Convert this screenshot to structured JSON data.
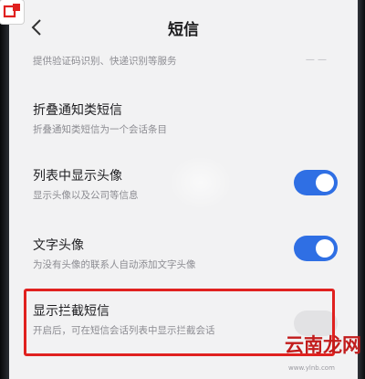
{
  "header": {
    "title": "短信"
  },
  "top_item": {
    "desc": "提供验证码识别、快递识别等服务"
  },
  "settings": [
    {
      "title": "折叠通知类短信",
      "desc": "折叠通知类短信为一个会话条目",
      "toggle": null
    },
    {
      "title": "列表中显示头像",
      "desc": "显示头像以及公司等信息",
      "toggle": "on"
    },
    {
      "title": "文字头像",
      "desc": "为没有头像的联系人自动添加文字头像",
      "toggle": "on"
    },
    {
      "title": "显示拦截短信",
      "desc": "开启后，可在短信会话列表中显示拦截会话",
      "toggle": "off-faint"
    }
  ],
  "watermark": {
    "text": "云南龙网",
    "url": "www.ylnb.com"
  },
  "colors": {
    "accent": "#2f6fe4",
    "highlight": "#e0211f"
  }
}
